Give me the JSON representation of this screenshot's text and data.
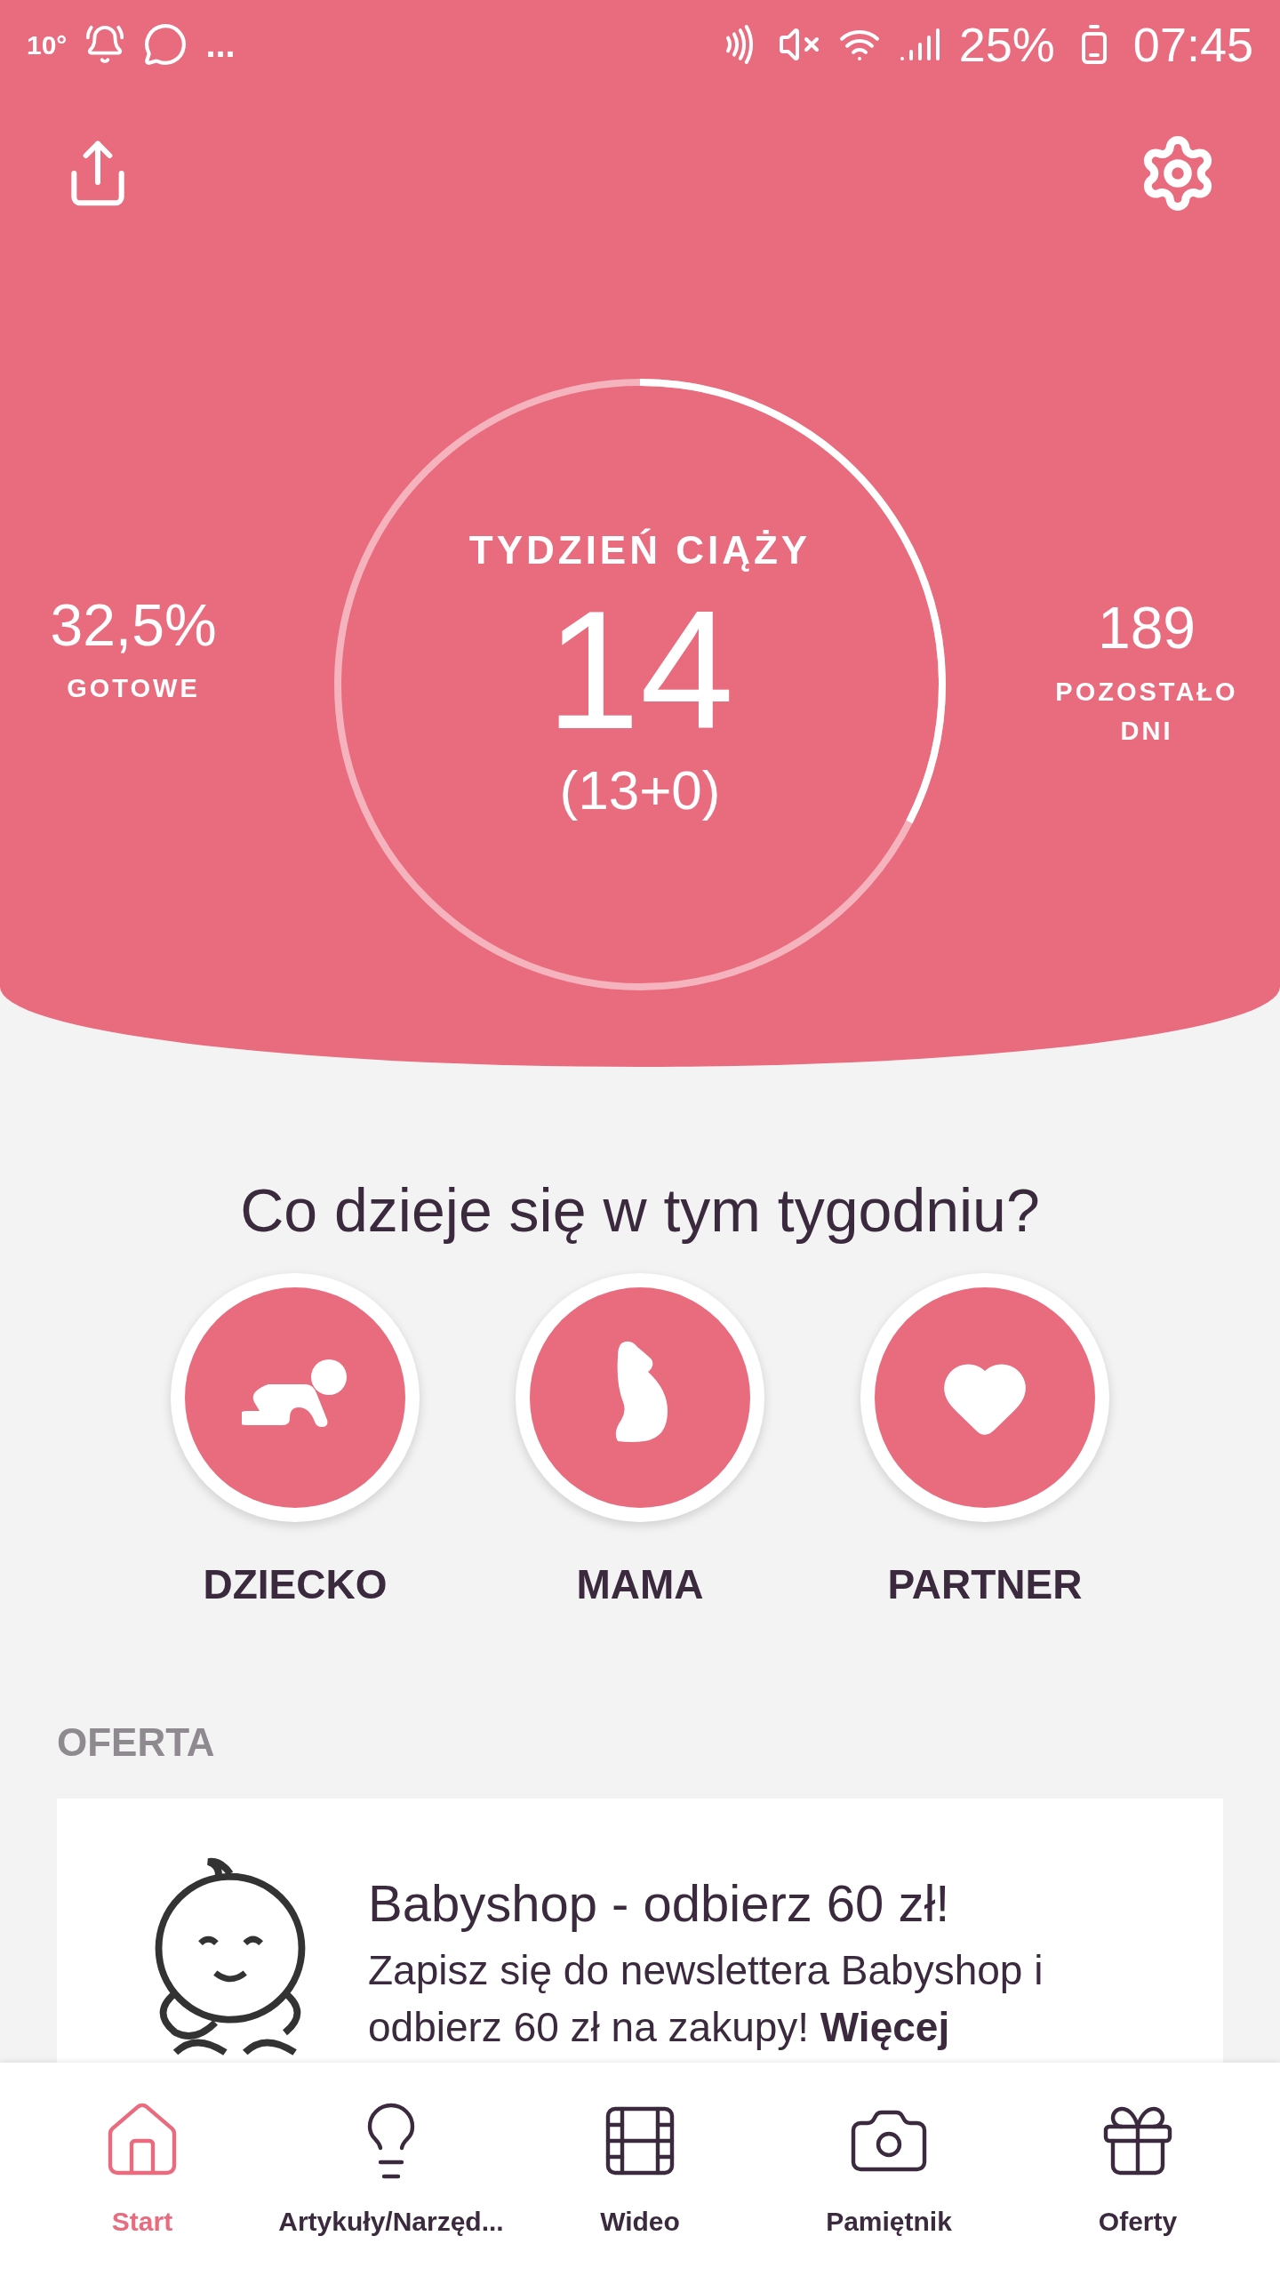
{
  "status_bar": {
    "temperature": "10°",
    "more": "...",
    "battery": "25%",
    "time": "07:45"
  },
  "header": {
    "left": {
      "value": "32,5%",
      "label": "GOTOWE"
    },
    "ring": {
      "title": "TYDZIEŃ CIĄŻY",
      "week": "14",
      "detail": "(13+0)"
    },
    "right": {
      "value": "189",
      "label": "POZOSTAŁO DNI"
    }
  },
  "section_title": "Co dzieje się w tym tygodniu?",
  "categories": [
    {
      "kind": "baby",
      "label": "DZIECKO"
    },
    {
      "kind": "mother",
      "label": "MAMA"
    },
    {
      "kind": "heart",
      "label": "PARTNER"
    }
  ],
  "offer": {
    "heading": "OFERTA",
    "title": "Babyshop - odbierz 60 zł!",
    "text": "Zapisz się do newslettera Babyshop i odbierz 60 zł na zakupy! **Więcej**"
  },
  "nav": [
    {
      "kind": "home",
      "label": "Start",
      "selected": true
    },
    {
      "kind": "bulb",
      "label": "Artykuły/Narzęd...",
      "selected": false
    },
    {
      "kind": "video",
      "label": "Wideo",
      "selected": false
    },
    {
      "kind": "camera",
      "label": "Pamiętnik",
      "selected": false
    },
    {
      "kind": "gift",
      "label": "Oferty",
      "selected": false
    }
  ]
}
